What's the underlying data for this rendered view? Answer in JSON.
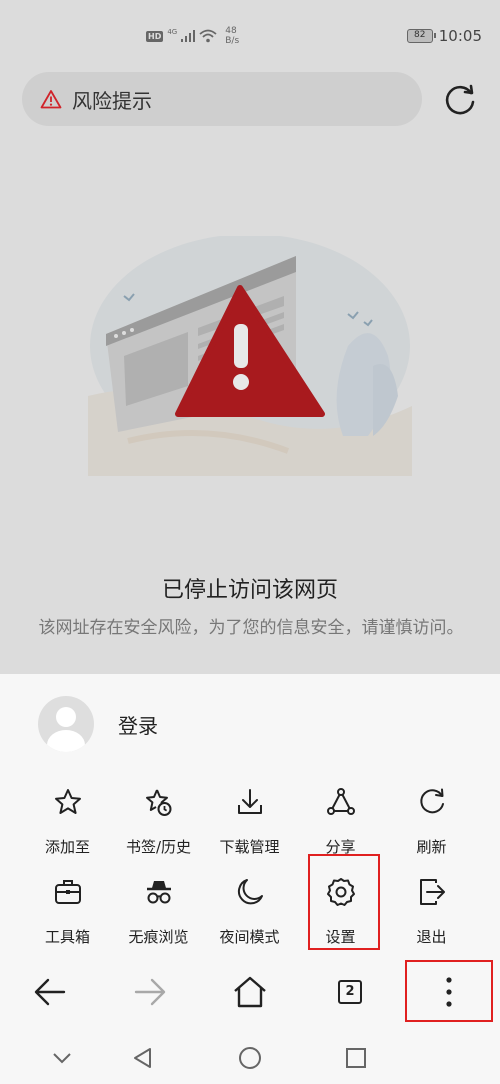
{
  "status_bar": {
    "hd": "HD",
    "network": "4G",
    "speed_value": "48",
    "speed_unit": "B/s",
    "battery": "82",
    "time": "10:05"
  },
  "top_bar": {
    "risk_label": "风险提示",
    "refresh_icon": "refresh-icon"
  },
  "page": {
    "title": "已停止访问该网页",
    "description": "该网址存在安全风险，为了您的信息安全，请谨慎访问。"
  },
  "menu": {
    "login_label": "登录",
    "row1": [
      {
        "label": "添加至",
        "icon": "star-icon"
      },
      {
        "label": "书签/历史",
        "icon": "bookmark-history-icon"
      },
      {
        "label": "下载管理",
        "icon": "download-icon"
      },
      {
        "label": "分享",
        "icon": "share-icon"
      },
      {
        "label": "刷新",
        "icon": "refresh-icon"
      }
    ],
    "row2": [
      {
        "label": "工具箱",
        "icon": "toolbox-icon"
      },
      {
        "label": "无痕浏览",
        "icon": "incognito-icon"
      },
      {
        "label": "夜间模式",
        "icon": "moon-icon"
      },
      {
        "label": "设置",
        "icon": "gear-icon"
      },
      {
        "label": "退出",
        "icon": "exit-icon"
      }
    ]
  },
  "bottom_nav": {
    "tab_count": "2"
  },
  "colors": {
    "highlight": "#e02020",
    "warning_red": "#c0151b"
  }
}
